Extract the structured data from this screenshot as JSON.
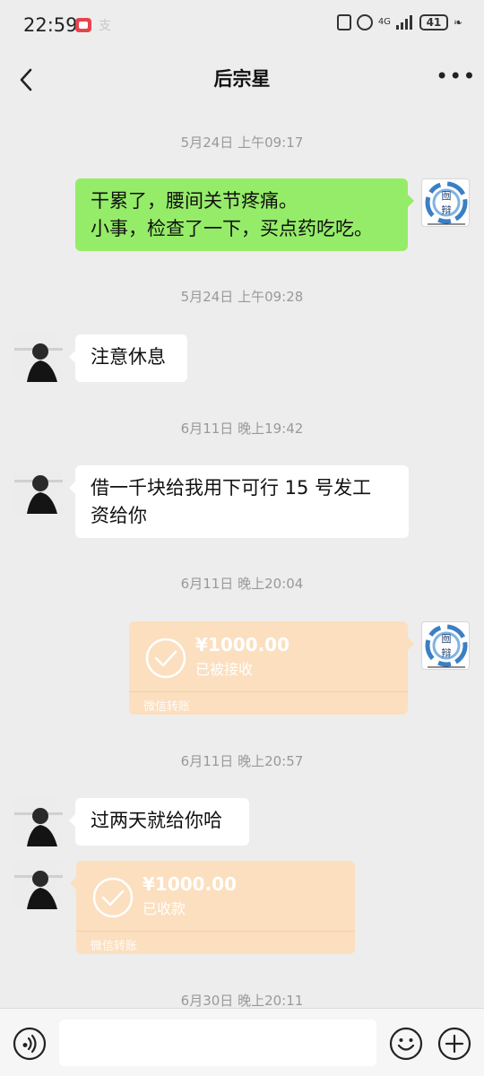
{
  "status_bar": {
    "time": "22:59",
    "alipay_glyph": "支",
    "network": "4G",
    "battery": "41"
  },
  "header": {
    "title": "后宗星",
    "back_icon": "chevron-left-icon",
    "more_icon": "ellipsis-icon",
    "more_glyph": "•••"
  },
  "self_avatar_text": "囫 辩",
  "messages": [
    {
      "type": "timestamp",
      "text": "5月24日 上午09:17"
    },
    {
      "type": "text",
      "side": "right",
      "lines": [
        "干累了，腰间关节疼痛。",
        "小事，检查了一下，买点药吃吃。"
      ]
    },
    {
      "type": "timestamp",
      "text": "5月24日 上午09:28"
    },
    {
      "type": "text",
      "side": "left",
      "text": "注意休息"
    },
    {
      "type": "timestamp",
      "text": "6月11日 晚上19:42"
    },
    {
      "type": "text",
      "side": "left",
      "lines": [
        "借一千块给我用下可行  15 号发工",
        "资给你"
      ]
    },
    {
      "type": "timestamp",
      "text": "6月11日 晚上20:04"
    },
    {
      "type": "transfer",
      "side": "right",
      "amount": "¥1000.00",
      "status": "已被接收",
      "source": "微信转账"
    },
    {
      "type": "timestamp",
      "text": "6月11日 晚上20:57"
    },
    {
      "type": "text",
      "side": "left",
      "text": "过两天就给你哈"
    },
    {
      "type": "transfer",
      "side": "left",
      "amount": "¥1000.00",
      "status": "已收款",
      "source": "微信转账"
    },
    {
      "type": "timestamp",
      "text": "6月30日 晚上20:11"
    }
  ],
  "input_bar": {
    "voice_icon": "voice-icon",
    "input_value": "",
    "emoji_icon": "emoji-icon",
    "plus_icon": "plus-icon"
  },
  "colors": {
    "background": "#ededed",
    "sent_bubble": "#95ec69",
    "received_bubble": "#ffffff",
    "transfer_card": "#fbdfbf",
    "timestamp": "#999999"
  }
}
